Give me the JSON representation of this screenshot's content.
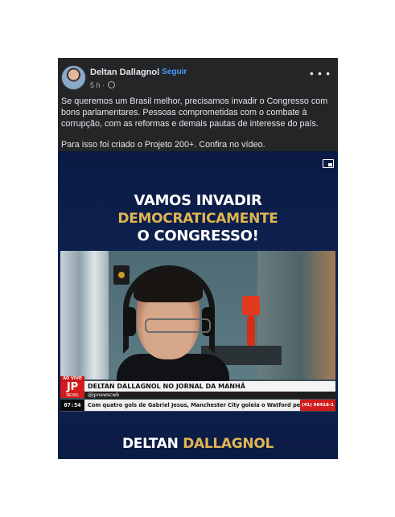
{
  "post": {
    "author": "Deltan Dallagnol",
    "follow_separator": "·",
    "follow_label": "Seguir",
    "time_ago": "5 h",
    "meta_separator": "·",
    "privacy_icon": "globe-icon",
    "more_icon": "more-options-icon",
    "paragraph_1": "Se queremos um Brasil melhor, precisamos invadir o Congresso com bons parlamentares. Pessoas comprometidas com o combate à corrupção, com as reformas e demais pautas de interesse do país.",
    "paragraph_2": "Para isso foi criado o Projeto 200+. Confira no vídeo."
  },
  "video": {
    "pip_icon": "picture-in-picture-icon",
    "headline_line_1": "VAMOS INVADIR",
    "headline_line_2": "DEMOCRATICAMENTE",
    "headline_line_3": "O CONGRESSO!",
    "broadcast": {
      "live_badge": "AO VIVO",
      "logo_text": "JP",
      "logo_subtext": "NEWS",
      "time": "07:54",
      "name_bar": "DELTAN DALLAGNOL NO JORNAL DA MANHÃ",
      "handle": "@jpnewscwb",
      "ticker": "Com quatro gols de Gabriel Jesus, Manchester City goleia o Watford pelo Inglês",
      "phone": "(41) 98418-1"
    },
    "footer_first": "DELTAN",
    "footer_last": "DALLAGNOL"
  },
  "colors": {
    "card_bg": "#242526",
    "link_blue": "#4599ff",
    "headline_gold": "#e0b552",
    "video_navy": "#0f2355",
    "jp_red": "#d21c1c"
  }
}
